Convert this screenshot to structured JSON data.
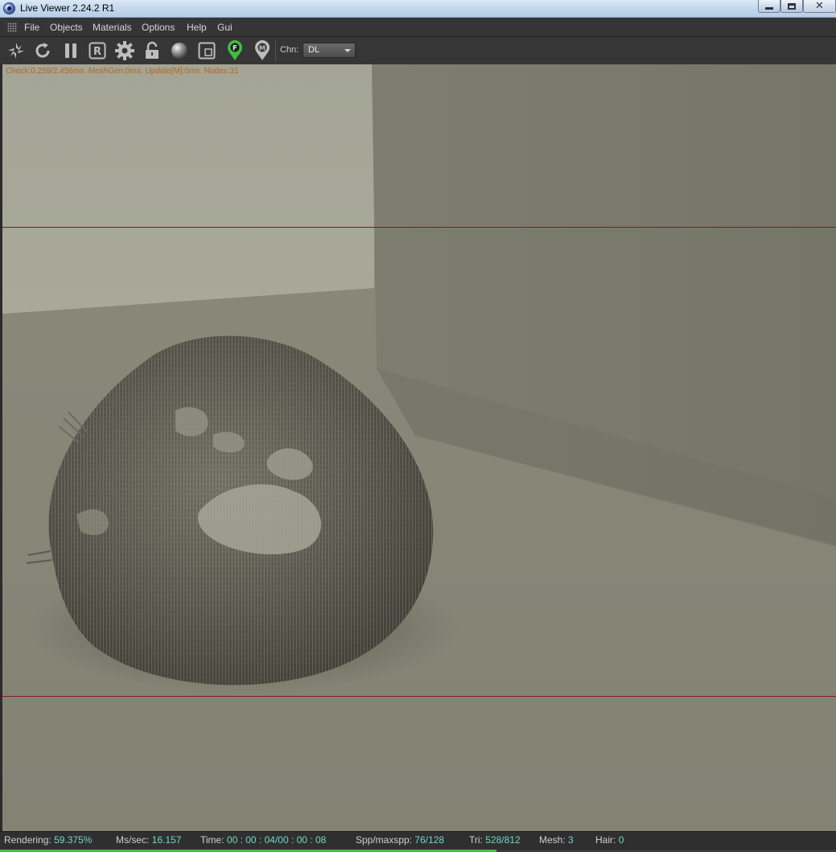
{
  "window": {
    "title": "Live Viewer 2.24.2 R1",
    "controls": {
      "close_glyph": "✕"
    }
  },
  "menu": {
    "items": [
      "File",
      "Objects",
      "Materials",
      "Options",
      "Help",
      "Gui"
    ]
  },
  "toolbar": {
    "icons": [
      "render-aperture-icon",
      "refresh-icon",
      "pause-icon",
      "region-render-icon",
      "settings-gear-icon",
      "lock-icon",
      "material-sphere-icon",
      "bounding-box-icon",
      "focus-pin-icon",
      "material-pin-icon"
    ],
    "pin_letters": {
      "focus": "F",
      "material": "M"
    },
    "channel": {
      "label": "Chn:",
      "value": "DL"
    },
    "accent_green": "#3fbf3f"
  },
  "viewport": {
    "stats_overlay": "Check:0.259/2.456ms. MeshGen:0ms. Update[M]:0ms. Nodes:31",
    "region_line_color": "#7a1f1a"
  },
  "status": {
    "rendering_label": "Rendering:",
    "rendering_value": "59.375%",
    "mssec_label": "Ms/sec:",
    "mssec_value": "16.157",
    "time_label": "Time:",
    "time_value": "00 : 00 : 04/00 : 00 : 08",
    "spp_label": "Spp/maxspp:",
    "spp_value": "76/128",
    "tri_label": "Tri:",
    "tri_value": "528/812",
    "mesh_label": "Mesh:",
    "mesh_value": "3",
    "hair_label": "Hair:",
    "hair_value": "0",
    "progress_fraction": 0.59375
  }
}
